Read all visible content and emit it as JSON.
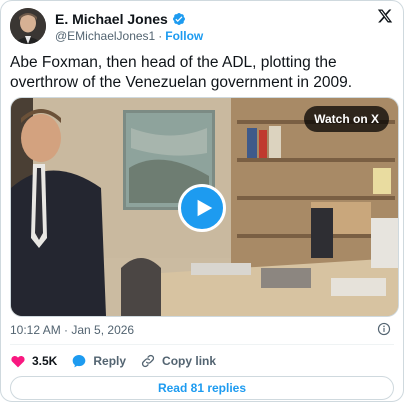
{
  "author": {
    "name": "E. Michael Jones",
    "handle": "@EMichaelJones1",
    "separator": "·",
    "follow_label": "Follow"
  },
  "tweet": {
    "text": "Abe Foxman, then head of the ADL, plotting the overthrow of the Venezuelan government in 2009."
  },
  "media": {
    "watch_label": "Watch on X"
  },
  "timestamp": "10:12 AM · Jan 5, 2026",
  "actions": {
    "likes": "3.5K",
    "reply_label": "Reply",
    "copy_label": "Copy link"
  },
  "replies_button": "Read 81 replies",
  "colors": {
    "accent": "#1d9bf0",
    "like": "#f91880",
    "secondary_text": "#536471",
    "border": "#cfd9de"
  },
  "icons": [
    "verified-badge-icon",
    "x-logo-icon",
    "play-icon",
    "info-icon",
    "heart-icon",
    "reply-icon",
    "link-icon"
  ]
}
